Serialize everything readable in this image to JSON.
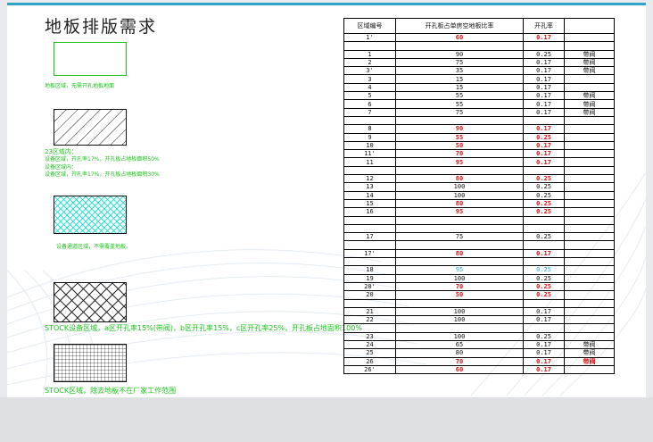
{
  "title": "地板排版需求",
  "notes": {
    "note1": "地板区域，无需开孔地板地面",
    "note2a": "23区域内：",
    "note2b": "设备区域，开孔率17%，开孔板占地板面积50%",
    "note2c": "设备区域内：",
    "note2d": "设备区域，开孔率17%，开孔板占地板面积30%",
    "note3": "设备通道区域，不需覆盖地板。",
    "note4": "STOCK设备区域，a区开孔率15%(带阀)，b区开孔率15%，c区开孔率25%，开孔板占地面积100%",
    "note5": "STOCK区域，除去地板不在厂家工作范围"
  },
  "table": {
    "headers": [
      "区域编号",
      "开孔板占单房空地板比率",
      "开孔率",
      ""
    ],
    "rows": [
      {
        "zone": "1'",
        "ratio": "60",
        "rate": "0.17",
        "valve": "",
        "style": "red"
      },
      {
        "zone": "",
        "ratio": "",
        "rate": "",
        "valve": "",
        "style": ""
      },
      {
        "zone": "1",
        "ratio": "90",
        "rate": "0.25",
        "valve": "带阀",
        "style": ""
      },
      {
        "zone": "2",
        "ratio": "75",
        "rate": "0.17",
        "valve": "带阀",
        "style": ""
      },
      {
        "zone": "3'",
        "ratio": "35",
        "rate": "0.17",
        "valve": "带阀",
        "style": ""
      },
      {
        "zone": "3",
        "ratio": "15",
        "rate": "0.17",
        "valve": "",
        "style": ""
      },
      {
        "zone": "4",
        "ratio": "15",
        "rate": "0.17",
        "valve": "",
        "style": ""
      },
      {
        "zone": "5",
        "ratio": "55",
        "rate": "0.17",
        "valve": "带阀",
        "style": ""
      },
      {
        "zone": "6",
        "ratio": "55",
        "rate": "0.17",
        "valve": "带阀",
        "style": ""
      },
      {
        "zone": "7",
        "ratio": "75",
        "rate": "0.17",
        "valve": "带阀",
        "style": ""
      },
      {
        "zone": "",
        "ratio": "",
        "rate": "",
        "valve": "",
        "style": ""
      },
      {
        "zone": "8",
        "ratio": "90",
        "rate": "0.17",
        "valve": "",
        "style": "red"
      },
      {
        "zone": "9",
        "ratio": "55",
        "rate": "0.25",
        "valve": "",
        "style": "red"
      },
      {
        "zone": "10",
        "ratio": "50",
        "rate": "0.17",
        "valve": "",
        "style": "red"
      },
      {
        "zone": "11'",
        "ratio": "70",
        "rate": "0.17",
        "valve": "",
        "style": "red"
      },
      {
        "zone": "11",
        "ratio": "95",
        "rate": "0.17",
        "valve": "",
        "style": "red"
      },
      {
        "zone": "",
        "ratio": "",
        "rate": "",
        "valve": "",
        "style": ""
      },
      {
        "zone": "12",
        "ratio": "80",
        "rate": "0.25",
        "valve": "",
        "style": "red"
      },
      {
        "zone": "13",
        "ratio": "100",
        "rate": "0.25",
        "valve": "",
        "style": ""
      },
      {
        "zone": "14",
        "ratio": "100",
        "rate": "0.25",
        "valve": "",
        "style": ""
      },
      {
        "zone": "15",
        "ratio": "80",
        "rate": "0.25",
        "valve": "",
        "style": "red"
      },
      {
        "zone": "16",
        "ratio": "95",
        "rate": "0.25",
        "valve": "",
        "style": "red"
      },
      {
        "zone": "",
        "ratio": "",
        "rate": "",
        "valve": "",
        "style": ""
      },
      {
        "zone": "",
        "ratio": "",
        "rate": "",
        "valve": "",
        "style": ""
      },
      {
        "zone": "17",
        "ratio": "75",
        "rate": "0.25",
        "valve": "",
        "style": ""
      },
      {
        "zone": "",
        "ratio": "",
        "rate": "",
        "valve": "",
        "style": ""
      },
      {
        "zone": "17'",
        "ratio": "80",
        "rate": "0.17",
        "valve": "",
        "style": "red"
      },
      {
        "zone": "",
        "ratio": "",
        "rate": "",
        "valve": "",
        "style": ""
      },
      {
        "zone": "18",
        "ratio": "95",
        "rate": "0.25",
        "valve": "",
        "style": "cyan"
      },
      {
        "zone": "19",
        "ratio": "100",
        "rate": "0.25",
        "valve": "",
        "style": ""
      },
      {
        "zone": "20'",
        "ratio": "70",
        "rate": "0.25",
        "valve": "",
        "style": "red"
      },
      {
        "zone": "20",
        "ratio": "50",
        "rate": "0.25",
        "valve": "",
        "style": "red"
      },
      {
        "zone": "",
        "ratio": "",
        "rate": "",
        "valve": "",
        "style": ""
      },
      {
        "zone": "21",
        "ratio": "100",
        "rate": "0.17",
        "valve": "",
        "style": ""
      },
      {
        "zone": "22",
        "ratio": "100",
        "rate": "0.17",
        "valve": "",
        "style": ""
      },
      {
        "zone": "",
        "ratio": "",
        "rate": "",
        "valve": "",
        "style": ""
      },
      {
        "zone": "23",
        "ratio": "100",
        "rate": "0.25",
        "valve": "",
        "style": ""
      },
      {
        "zone": "24",
        "ratio": "65",
        "rate": "0.17",
        "valve": "带阀",
        "style": ""
      },
      {
        "zone": "25",
        "ratio": "80",
        "rate": "0.17",
        "valve": "带阀",
        "style": ""
      },
      {
        "zone": "26",
        "ratio": "70",
        "rate": "0.17",
        "valve": "带阀",
        "style": "red"
      },
      {
        "zone": "26'",
        "ratio": "60",
        "rate": "0.17",
        "valve": "",
        "style": "red"
      }
    ]
  },
  "colors": {
    "accent": "#2fa6c7",
    "note_green": "#1cc51c",
    "highlight_red": "#e01010",
    "highlight_cyan": "#30a8e0",
    "hatch_cyan": "#00e0c8"
  }
}
